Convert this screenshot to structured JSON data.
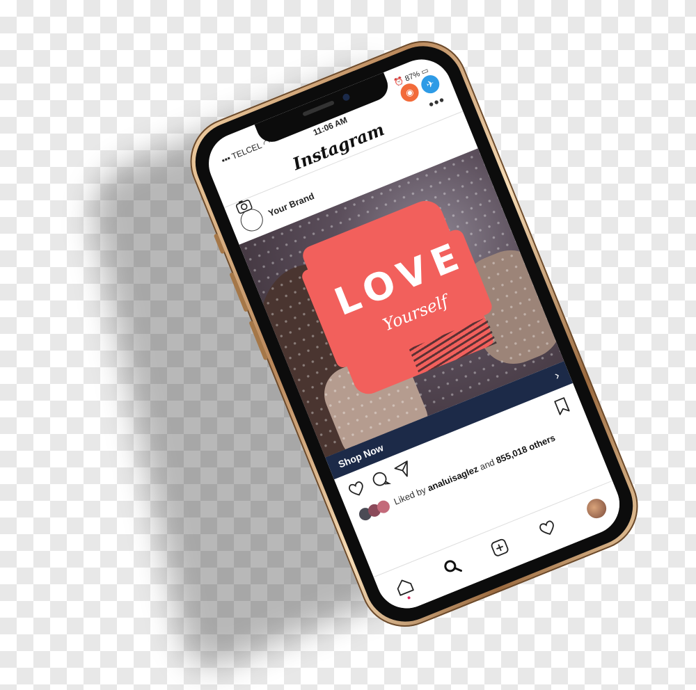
{
  "status": {
    "carrier": "TELCEL",
    "time": "11:06 AM",
    "battery": "87%"
  },
  "bubbles": [
    {
      "icon": "app-icon-orange",
      "color": "#f26b3a"
    },
    {
      "icon": "app-icon-blue",
      "color": "#2e9be6"
    }
  ],
  "header": {
    "logo": "Instagram",
    "camera_icon": "camera-icon",
    "more_icon": "more-dots-icon"
  },
  "post": {
    "brand": "Your Brand",
    "image_text": {
      "title": "LOVE",
      "subtitle": "Yourself"
    },
    "cta": "Shop Now",
    "cta_color": "#1c2a48",
    "liked_prefix": "Liked by",
    "liked_user": "analuisaglez",
    "liked_and": "and",
    "liked_count": "855,018 others"
  },
  "tabs": [
    "home-icon",
    "search-icon",
    "add-icon",
    "heart-icon",
    "profile-avatar"
  ],
  "colors": {
    "accent": "#f2605c",
    "banner": "#1c2a48",
    "frame": "#c9995f"
  }
}
